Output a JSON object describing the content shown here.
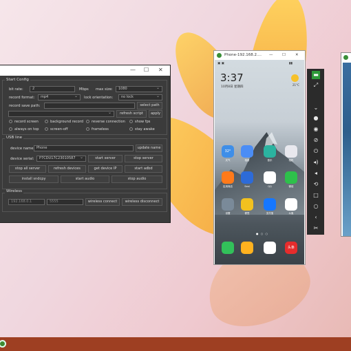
{
  "config_window": {
    "title": "",
    "window_controls": {
      "minimize": "—",
      "maximize": "☐",
      "close": "✕"
    },
    "start_config": {
      "title": "Start Config",
      "bit_rate_label": "bit rate:",
      "bit_rate_value": "2",
      "bit_rate_unit": "Mbps",
      "max_size_label": "max size:",
      "max_size_value": "1080",
      "record_format_label": "record format:",
      "record_format_value": "mp4",
      "lock_orientation_label": "lock orientation:",
      "lock_orientation_value": "no lock",
      "record_save_path_label": "record save path:",
      "record_save_path_value": "",
      "select_path_button": "select path",
      "script_value": "",
      "refresh_script_button": "refresh script",
      "apply_button": "apply",
      "options": [
        "record screen",
        "background record",
        "reverse connection",
        "show fps",
        "always on top",
        "screen-off",
        "frameless",
        "stay awake"
      ]
    },
    "usb_line": {
      "title": "USB line",
      "device_name_label": "device name:",
      "device_name_value": "Phone",
      "update_name_button": "update name",
      "device_serial_label": "device serial:",
      "device_serial_value": "P7CDU17C23010587",
      "start_server_button": "start server",
      "stop_server_button": "stop server",
      "stop_all_server_button": "stop all server",
      "refresh_devices_button": "refresh devices",
      "get_device_ip_button": "get device IP",
      "start_adbd_button": "start adbd",
      "install_sndcpy_button": "install sndcpy",
      "start_audio_button": "start audio",
      "stop_audio_button": "stop audio"
    },
    "wireless": {
      "title": "Wireless",
      "ip_value": "192.168.0.1",
      "port_value": "5555",
      "wireless_connect_button": "wireless connect",
      "wireless_disconnect_button": "wireless disconnect"
    }
  },
  "phone_window": {
    "title": "Phone-192.168.2....",
    "window_controls": {
      "minimize": "—",
      "maximize": "☐",
      "close": "✕"
    },
    "screen": {
      "clock": "3:37",
      "date": "10月8日 星期四",
      "temperature": "21°C",
      "apps_row1": [
        {
          "label": "天气",
          "color": "#3e8ee8",
          "text": "32°"
        },
        {
          "label": "相册",
          "color": "#4b8df5",
          "text": ""
        },
        {
          "label": "音乐",
          "color": "#2bb3a0",
          "text": ""
        },
        {
          "label": "相机",
          "color": "#e8e8ee",
          "text": ""
        }
      ],
      "apps_row2": [
        {
          "label": "应用商店",
          "color": "#ff7a1a",
          "text": ""
        },
        {
          "label": "Seal",
          "color": "#2d6bd8",
          "text": ""
        },
        {
          "label": "QQ",
          "color": "#ffffff",
          "text": ""
        },
        {
          "label": "微信",
          "color": "#2ec04b",
          "text": ""
        }
      ],
      "apps_row3": [
        {
          "label": "设置",
          "color": "#7a8a99",
          "text": ""
        },
        {
          "label": "便签",
          "color": "#f2c11f",
          "text": ""
        },
        {
          "label": "支付宝",
          "color": "#1677ff",
          "text": ""
        },
        {
          "label": "斗鱼",
          "color": "#ffffff",
          "text": ""
        }
      ],
      "dock": [
        {
          "color": "#32c05a",
          "text": "",
          "icon": "phone-icon"
        },
        {
          "color": "#ffb21f",
          "text": "",
          "icon": "notes-icon"
        },
        {
          "color": "#ffffff",
          "text": "",
          "icon": "chrome-icon"
        },
        {
          "color": "#e62c2c",
          "text": "头条",
          "icon": "news-icon"
        }
      ]
    }
  },
  "sidebar_buttons": [
    "app-switch-icon",
    "fullscreen-icon",
    "chevron-down-icon",
    "circle-icon",
    "eye-icon",
    "eye-slash-icon",
    "power-icon",
    "volume-up-icon",
    "volume-down-icon",
    "rotate-icon",
    "square-icon",
    "circle-outline-icon",
    "back-icon",
    "screenshot-icon"
  ]
}
